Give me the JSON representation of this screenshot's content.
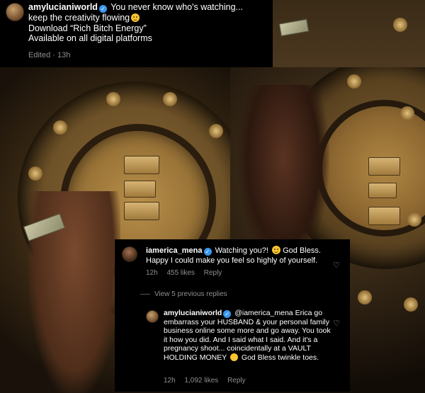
{
  "caption": {
    "username": "amylucianiworld",
    "line1": "You never know who's watching...",
    "line2": "keep the creativity flowing",
    "line3": "Download “Rich Bitch Energy”",
    "line4": "Available on all digital platforms",
    "meta": "Edited · 13h",
    "emoji_icon": "smiling-face-emoji"
  },
  "comments": [
    {
      "username": "iamerica_mena",
      "text_part1": "Watching you?!",
      "text_part2": "God Bless. Happy I could make you feel so highly of yourself.",
      "time": "12h",
      "likes": "455 likes",
      "reply_label": "Reply",
      "emoji_icon": "grinning-sweat-emoji"
    },
    {
      "username": "amylucianiworld",
      "mention": "@iamerica_mena",
      "text_part1": "Erica go embarrass your HUSBAND & your personal family business online some more and go away. You took it how you did. And I said what I said. And it's a pregnancy shoot... coincidentally at a VAULT HOLDING MONEY",
      "text_part2": "God Bless twinkle toes.",
      "time": "12h",
      "likes": "1,092 likes",
      "reply_label": "Reply",
      "emoji_icon": "thinking-face-emoji"
    }
  ],
  "view_replies_label": "View 5 previous replies",
  "colors": {
    "verified": "#3897f0",
    "meta_gray": "#8e8e8e",
    "card_bg": "#000000"
  }
}
